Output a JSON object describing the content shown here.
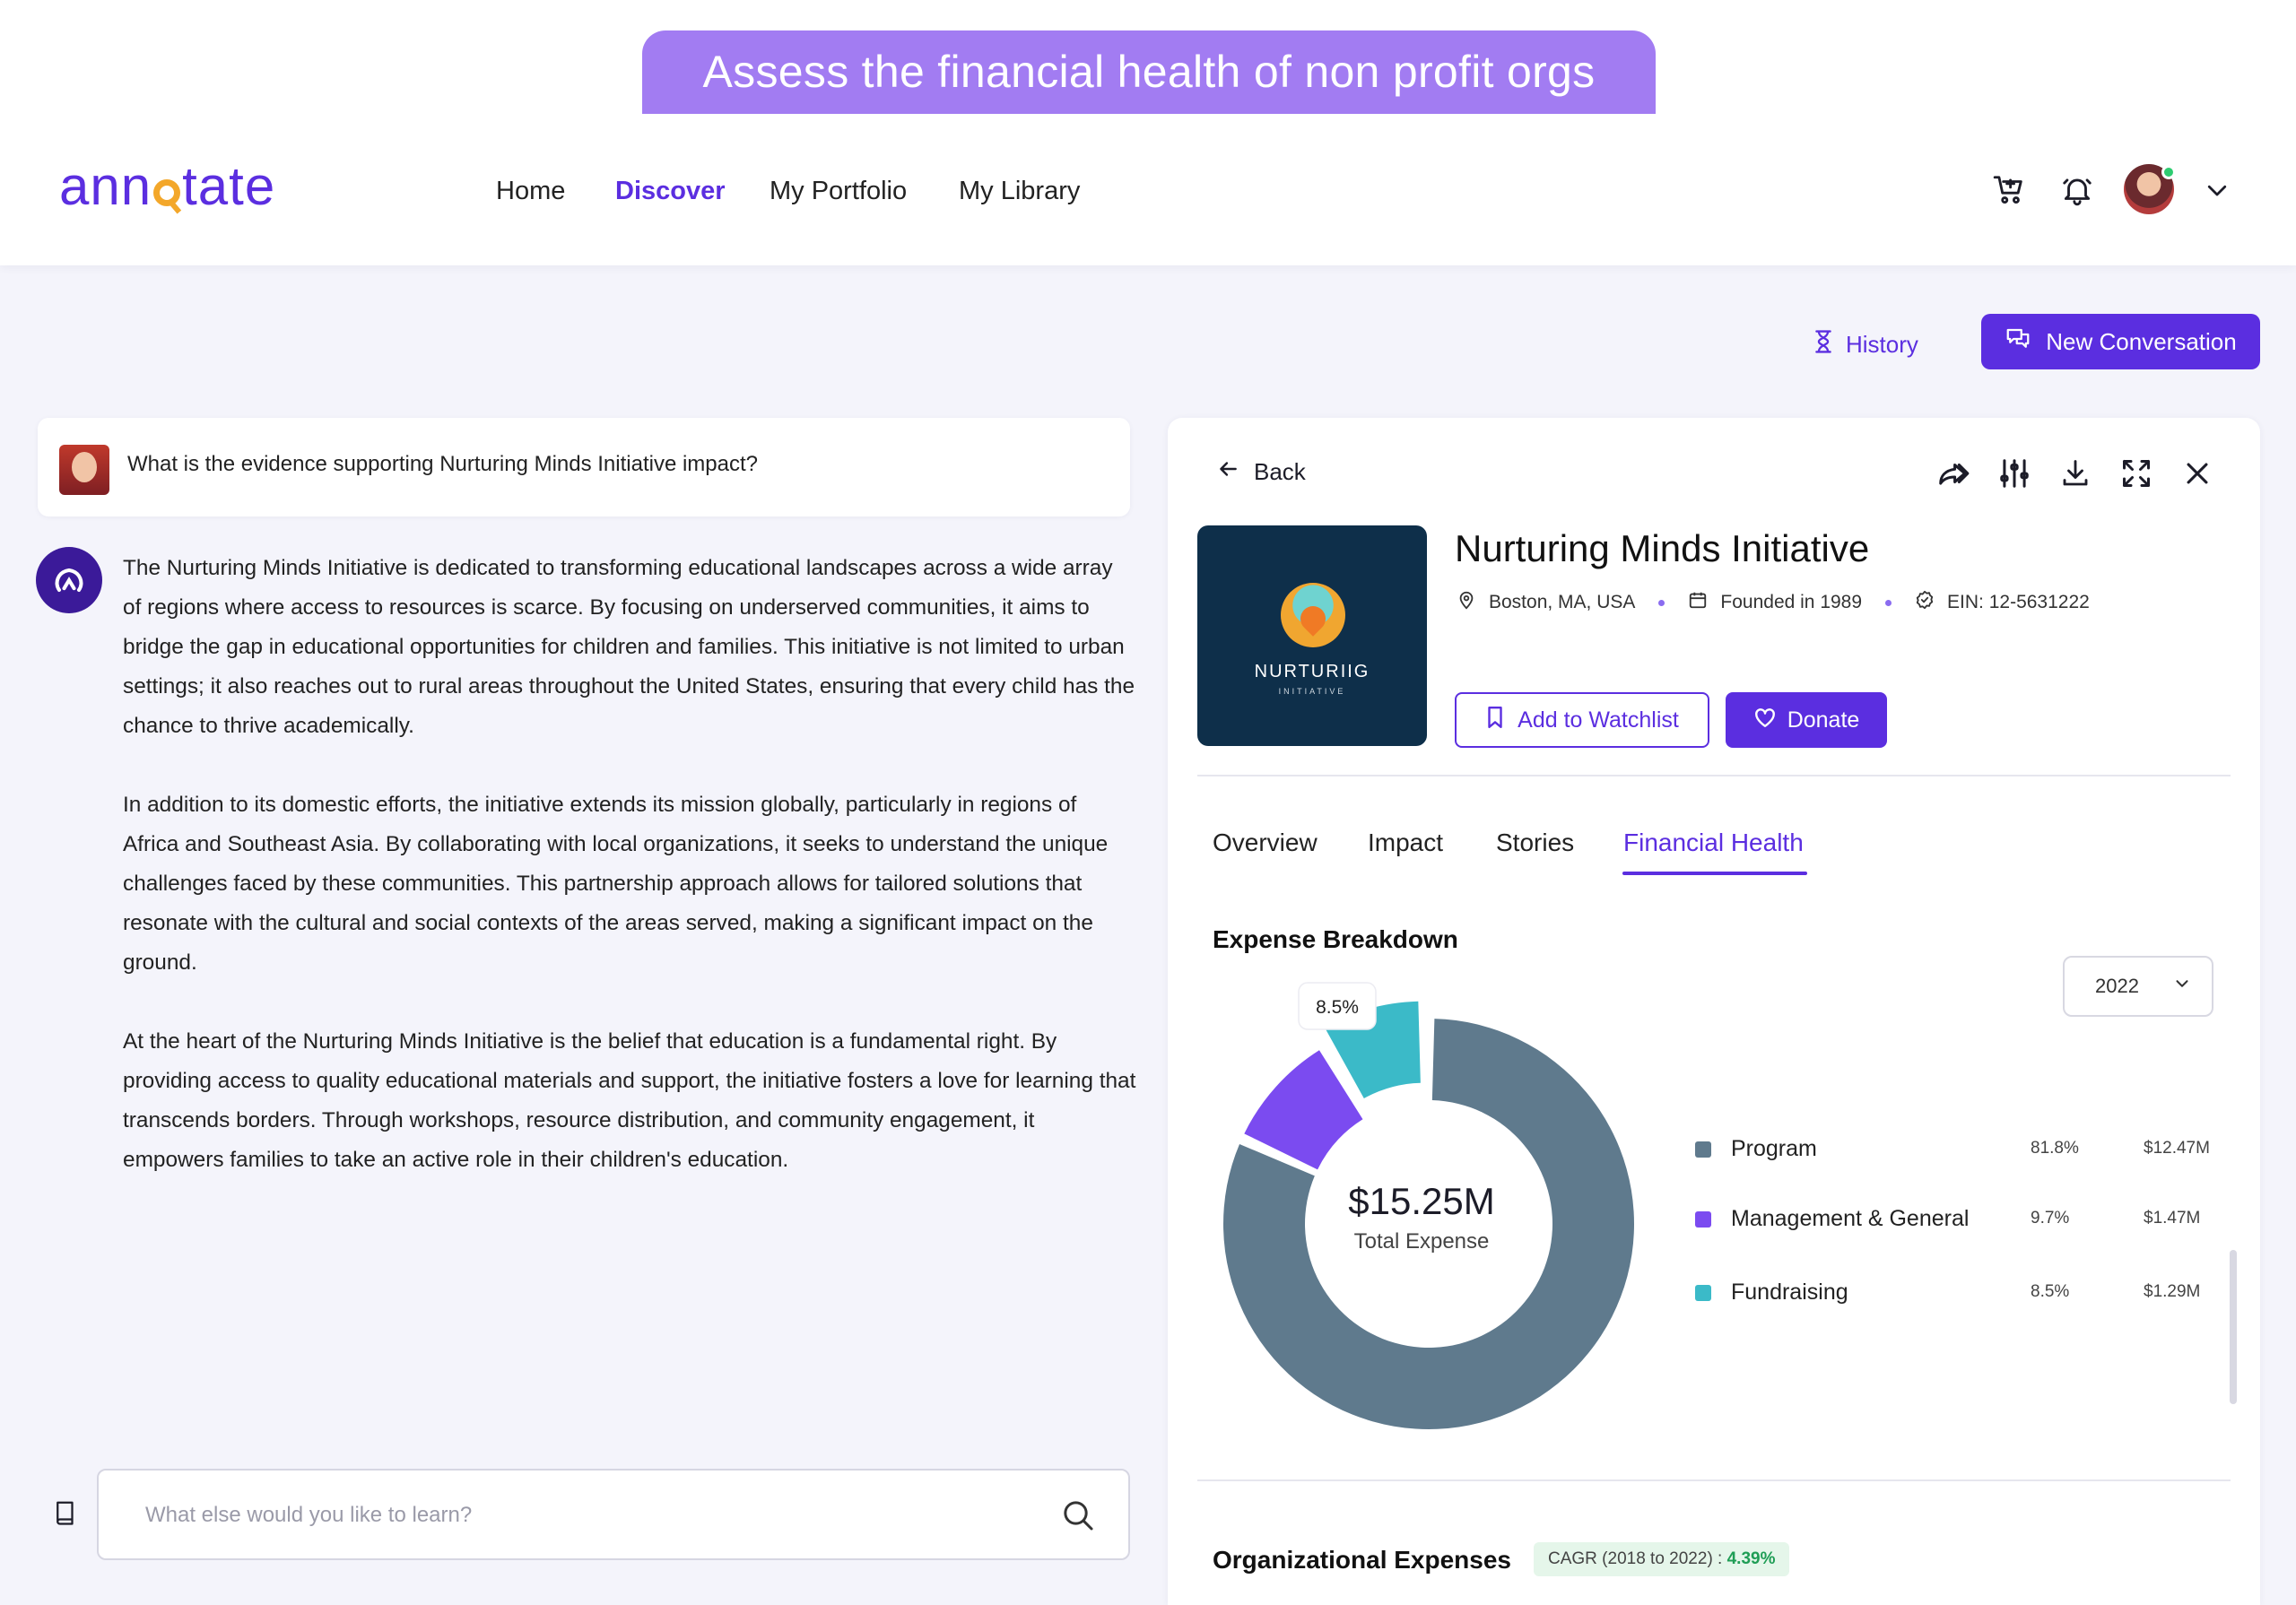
{
  "banner": {
    "text": "Assess the financial health of non profit orgs"
  },
  "header": {
    "logo_start": "ann",
    "logo_end": "tate",
    "nav": [
      {
        "label": "Home"
      },
      {
        "label": "Discover"
      },
      {
        "label": "My Portfolio"
      },
      {
        "label": "My Library"
      }
    ],
    "icons": [
      "cart-icon",
      "bell-icon",
      "avatar",
      "chevron-down-icon"
    ]
  },
  "toolbar": {
    "history_label": "History",
    "new_conversation_label": "New Conversation"
  },
  "chat": {
    "question": "What is the evidence supporting Nurturing Minds Initiative impact?",
    "answer_paragraphs": [
      "The Nurturing Minds Initiative is dedicated to transforming educational landscapes across a wide array of regions where access to resources is scarce. By focusing on underserved communities, it aims to bridge the gap in educational opportunities for children and families. This initiative is not limited to urban settings; it also reaches out to rural areas throughout the United States, ensuring that every child has the chance to thrive academically.",
      "In addition to its domestic efforts, the initiative extends its mission globally, particularly in regions of Africa and Southeast Asia. By collaborating with local organizations, it seeks to understand the unique challenges faced by these communities. This partnership approach allows for tailored solutions that resonate with the cultural and social contexts of the areas served, making a significant impact on the ground.",
      "At the heart of the Nurturing Minds Initiative is the belief that education is a fundamental right. By providing access to quality educational materials and support, the initiative fosters a love for learning that transcends borders. Through workshops, resource distribution, and community engagement, it empowers families to take an active role in their children's education."
    ],
    "input_placeholder": "What else would you like to learn?",
    "input_value": ""
  },
  "panel": {
    "back_label": "Back",
    "tools": [
      "share-icon",
      "filter-sliders-icon",
      "download-icon",
      "expand-icon",
      "close-icon"
    ],
    "org": {
      "name": "Nurturing Minds Initiative",
      "logo_line1": "NURTURIIG",
      "logo_line2": "INITIATIVE",
      "location": "Boston, MA, USA",
      "founded": "Founded in 1989",
      "ein": "EIN: 12-5631222"
    },
    "watchlist_label": "Add to Watchlist",
    "donate_label": "Donate",
    "tabs": [
      {
        "label": "Overview"
      },
      {
        "label": "Impact"
      },
      {
        "label": "Stories"
      },
      {
        "label": "Financial Health"
      }
    ],
    "active_tab": "Financial Health",
    "expense_title": "Expense Breakdown",
    "year": "2022",
    "org_expenses_title": "Organizational Expenses",
    "cagr_label": "CAGR (2018 to 2022) : ",
    "cagr_value": "4.39%"
  },
  "colors": {
    "accent": "#5b2ee0",
    "program": "#5f7a8d",
    "management": "#7b4bf0",
    "fundraising": "#3bbac8"
  },
  "chart_data": {
    "type": "pie",
    "title": "Expense Breakdown",
    "center_value": "$15.25M",
    "center_label": "Total Expense",
    "tooltip": "8.5%",
    "categories": [
      "Program",
      "Management & General",
      "Fundraising"
    ],
    "values": [
      81.8,
      9.7,
      8.5
    ],
    "percent_labels": [
      "81.8%",
      "9.7%",
      "8.5%"
    ],
    "amount_labels": [
      "$12.47M",
      "$1.47M",
      "$1.29M"
    ],
    "colors": [
      "#5f7a8d",
      "#7b4bf0",
      "#3bbac8"
    ],
    "highlighted": "Fundraising",
    "legend_position": "right"
  }
}
